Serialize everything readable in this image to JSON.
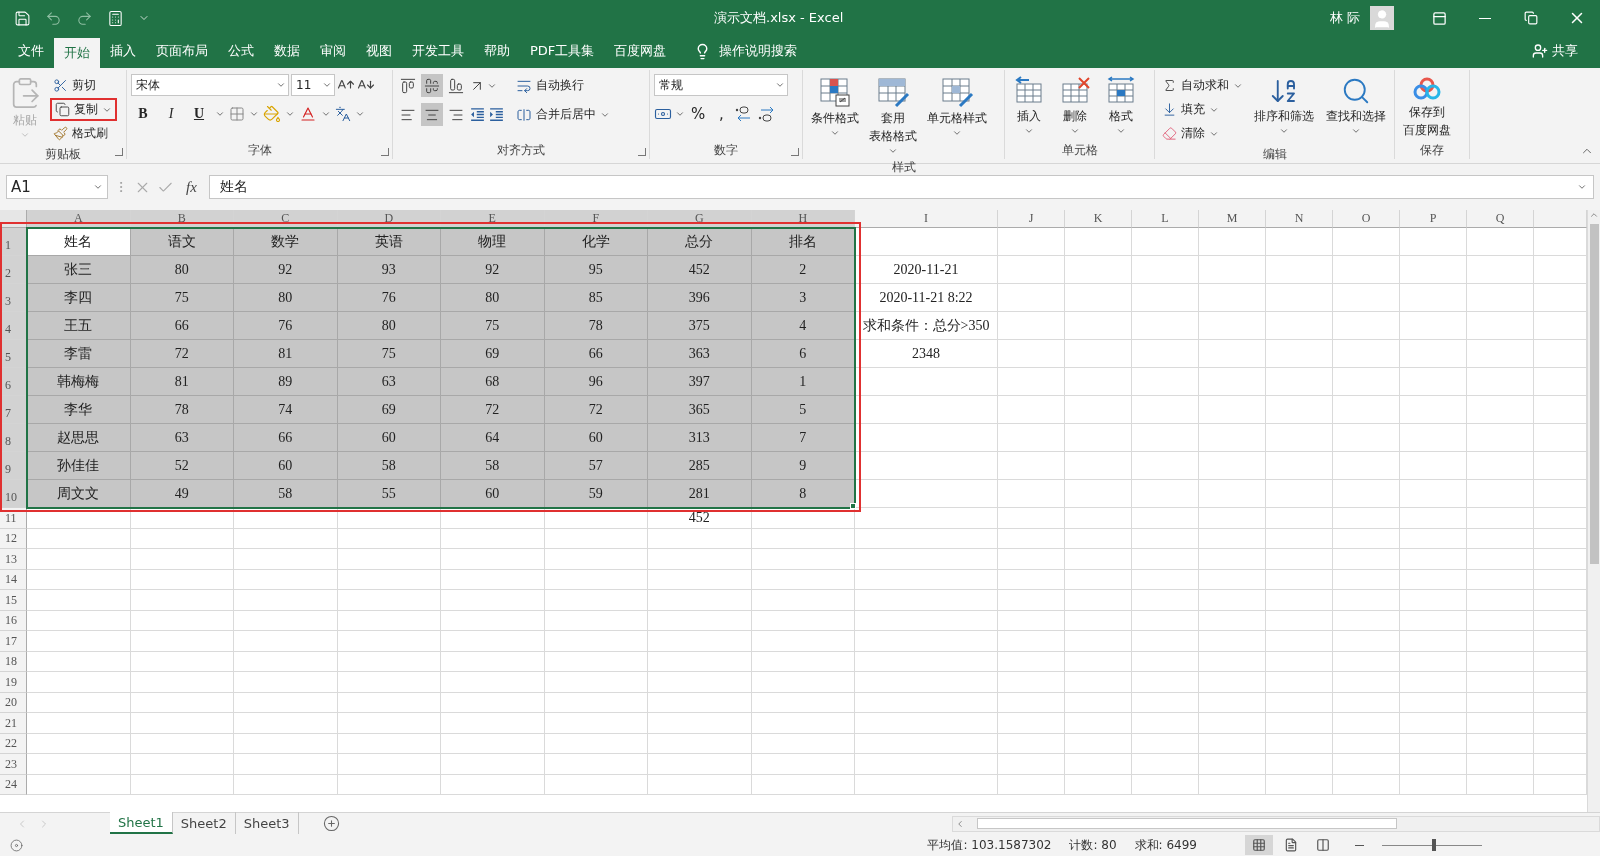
{
  "title_bar": {
    "title": "演示文档.xlsx  -  Excel",
    "user": "林 际"
  },
  "ribbon_tabs": [
    {
      "label": "文件",
      "selected": false
    },
    {
      "label": "开始",
      "selected": true
    },
    {
      "label": "插入",
      "selected": false
    },
    {
      "label": "页面布局",
      "selected": false
    },
    {
      "label": "公式",
      "selected": false
    },
    {
      "label": "数据",
      "selected": false
    },
    {
      "label": "审阅",
      "selected": false
    },
    {
      "label": "视图",
      "selected": false
    },
    {
      "label": "开发工具",
      "selected": false
    },
    {
      "label": "帮助",
      "selected": false
    },
    {
      "label": "PDF工具集",
      "selected": false
    },
    {
      "label": "百度网盘",
      "selected": false
    }
  ],
  "tell_me": "操作说明搜索",
  "share": "共享",
  "ribbon": {
    "clipboard": {
      "label": "剪贴板",
      "paste": {
        "label": "粘贴",
        "disabled": true
      },
      "cut": "剪切",
      "copy": {
        "label": "复制",
        "highlighted": true
      },
      "format_painter": "格式刷"
    },
    "font": {
      "label": "字体",
      "font_name": "宋体",
      "font_size": "11",
      "bold": "B",
      "italic": "I",
      "underline": "U"
    },
    "alignment": {
      "label": "对齐方式",
      "vertical_align": [
        {
          "selected": false
        },
        {
          "selected": true
        },
        {
          "selected": false
        }
      ],
      "horizontal_align": [
        {
          "selected": false
        },
        {
          "selected": true
        },
        {
          "selected": false
        }
      ],
      "wrap_text": "自动换行",
      "merge_center": "合并后居中"
    },
    "number": {
      "label": "数字",
      "format": "常规",
      "percent": "%",
      "comma": ","
    },
    "styles": {
      "label": "样式",
      "buttons": [
        {
          "kind": "conditional",
          "lines": [
            "条件格式"
          ]
        },
        {
          "kind": "table",
          "lines": [
            "套用",
            "表格格式"
          ]
        },
        {
          "kind": "cellstyle",
          "lines": [
            "单元格样式"
          ]
        }
      ]
    },
    "cells": {
      "label": "单元格",
      "buttons": [
        {
          "kind": "insert",
          "label": "插入"
        },
        {
          "kind": "delete",
          "label": "删除"
        },
        {
          "kind": "format",
          "label": "格式"
        }
      ]
    },
    "editing": {
      "label": "编辑",
      "autosum": "自动求和",
      "fill": "填充",
      "clear": "清除",
      "sort_filter": "排序和筛选",
      "find_select": "查找和选择"
    },
    "save": {
      "label": "保存",
      "lines": [
        "保存到",
        "百度网盘"
      ]
    }
  },
  "formula_bar": {
    "name_box": "A1",
    "function_label": "fx",
    "value": "姓名"
  },
  "sheet": {
    "highlighted": true,
    "columns": [
      {
        "label": "A",
        "selected": true
      },
      {
        "label": "B",
        "selected": true
      },
      {
        "label": "C",
        "selected": true
      },
      {
        "label": "D",
        "selected": true
      },
      {
        "label": "E",
        "selected": true
      },
      {
        "label": "F",
        "selected": true
      },
      {
        "label": "G",
        "selected": true
      },
      {
        "label": "H",
        "selected": true
      },
      {
        "label": "I",
        "selected": false
      },
      {
        "label": "J",
        "selected": false
      },
      {
        "label": "K",
        "selected": false
      },
      {
        "label": "L",
        "selected": false
      },
      {
        "label": "M",
        "selected": false
      },
      {
        "label": "N",
        "selected": false
      },
      {
        "label": "O",
        "selected": false
      },
      {
        "label": "P",
        "selected": false
      },
      {
        "label": "Q",
        "selected": false
      }
    ],
    "rows": [
      {
        "header": "1",
        "selected": true,
        "cells": [
          {
            "text": "姓名",
            "active": true
          },
          {
            "text": "语文",
            "active": false
          },
          {
            "text": "数学",
            "active": false
          },
          {
            "text": "英语",
            "active": false
          },
          {
            "text": "物理",
            "active": false
          },
          {
            "text": "化学",
            "active": false
          },
          {
            "text": "总分",
            "active": false
          },
          {
            "text": "排名",
            "active": false
          }
        ]
      },
      {
        "header": "2",
        "selected": true,
        "cells": [
          {
            "text": "张三",
            "active": false
          },
          {
            "text": "80",
            "active": false
          },
          {
            "text": "92",
            "active": false
          },
          {
            "text": "93",
            "active": false
          },
          {
            "text": "92",
            "active": false
          },
          {
            "text": "95",
            "active": false
          },
          {
            "text": "452",
            "active": false
          },
          {
            "text": "2",
            "active": false
          }
        ],
        "column_i": "2020-11-21"
      },
      {
        "header": "3",
        "selected": true,
        "cells": [
          {
            "text": "李四",
            "active": false
          },
          {
            "text": "75",
            "active": false
          },
          {
            "text": "80",
            "active": false
          },
          {
            "text": "76",
            "active": false
          },
          {
            "text": "80",
            "active": false
          },
          {
            "text": "85",
            "active": false
          },
          {
            "text": "396",
            "active": false
          },
          {
            "text": "3",
            "active": false
          }
        ],
        "column_i": "2020-11-21 8:22"
      },
      {
        "header": "4",
        "selected": true,
        "cells": [
          {
            "text": "王五",
            "active": false
          },
          {
            "text": "66",
            "active": false
          },
          {
            "text": "76",
            "active": false
          },
          {
            "text": "80",
            "active": false
          },
          {
            "text": "75",
            "active": false
          },
          {
            "text": "78",
            "active": false
          },
          {
            "text": "375",
            "active": false
          },
          {
            "text": "4",
            "active": false
          }
        ],
        "column_i": "求和条件：总分>350"
      },
      {
        "header": "5",
        "selected": true,
        "cells": [
          {
            "text": "李雷",
            "active": false
          },
          {
            "text": "72",
            "active": false
          },
          {
            "text": "81",
            "active": false
          },
          {
            "text": "75",
            "active": false
          },
          {
            "text": "69",
            "active": false
          },
          {
            "text": "66",
            "active": false
          },
          {
            "text": "363",
            "active": false
          },
          {
            "text": "6",
            "active": false
          }
        ],
        "column_i": "2348"
      },
      {
        "header": "6",
        "selected": true,
        "cells": [
          {
            "text": "韩梅梅",
            "active": false
          },
          {
            "text": "81",
            "active": false
          },
          {
            "text": "89",
            "active": false
          },
          {
            "text": "63",
            "active": false
          },
          {
            "text": "68",
            "active": false
          },
          {
            "text": "96",
            "active": false
          },
          {
            "text": "397",
            "active": false
          },
          {
            "text": "1",
            "active": false
          }
        ]
      },
      {
        "header": "7",
        "selected": true,
        "cells": [
          {
            "text": "李华",
            "active": false
          },
          {
            "text": "78",
            "active": false
          },
          {
            "text": "74",
            "active": false
          },
          {
            "text": "69",
            "active": false
          },
          {
            "text": "72",
            "active": false
          },
          {
            "text": "72",
            "active": false
          },
          {
            "text": "365",
            "active": false
          },
          {
            "text": "5",
            "active": false
          }
        ]
      },
      {
        "header": "8",
        "selected": true,
        "cells": [
          {
            "text": "赵思思",
            "active": false
          },
          {
            "text": "63",
            "active": false
          },
          {
            "text": "66",
            "active": false
          },
          {
            "text": "60",
            "active": false
          },
          {
            "text": "64",
            "active": false
          },
          {
            "text": "60",
            "active": false
          },
          {
            "text": "313",
            "active": false
          },
          {
            "text": "7",
            "active": false
          }
        ]
      },
      {
        "header": "9",
        "selected": true,
        "cells": [
          {
            "text": "孙佳佳",
            "active": false
          },
          {
            "text": "52",
            "active": false
          },
          {
            "text": "60",
            "active": false
          },
          {
            "text": "58",
            "active": false
          },
          {
            "text": "58",
            "active": false
          },
          {
            "text": "57",
            "active": false
          },
          {
            "text": "285",
            "active": false
          },
          {
            "text": "9",
            "active": false
          }
        ]
      },
      {
        "header": "10",
        "selected": true,
        "cells": [
          {
            "text": "周文文",
            "active": false
          },
          {
            "text": "49",
            "active": false
          },
          {
            "text": "58",
            "active": false
          },
          {
            "text": "55",
            "active": false
          },
          {
            "text": "60",
            "active": false
          },
          {
            "text": "59",
            "active": false
          },
          {
            "text": "281",
            "active": false
          },
          {
            "text": "8",
            "active": false
          }
        ]
      },
      {
        "header": "11",
        "selected": false,
        "column_g": "452"
      },
      {
        "header": "12",
        "selected": false
      },
      {
        "header": "13",
        "selected": false
      },
      {
        "header": "14",
        "selected": false
      },
      {
        "header": "15",
        "selected": false
      },
      {
        "header": "16",
        "selected": false
      },
      {
        "header": "17",
        "selected": false
      },
      {
        "header": "18",
        "selected": false
      },
      {
        "header": "19",
        "selected": false
      },
      {
        "header": "20",
        "selected": false
      },
      {
        "header": "21",
        "selected": false
      },
      {
        "header": "22",
        "selected": false
      },
      {
        "header": "23",
        "selected": false
      },
      {
        "header": "24",
        "selected": false
      }
    ]
  },
  "sheet_tabs": [
    {
      "label": "Sheet1",
      "selected": true
    },
    {
      "label": "Sheet2",
      "selected": false
    },
    {
      "label": "Sheet3",
      "selected": false
    }
  ],
  "status_bar": {
    "average": "平均值: 103.1587302",
    "count": "计数: 80",
    "sum": "求和: 6499",
    "zoom_slider": {
      "level": 0.5
    }
  }
}
